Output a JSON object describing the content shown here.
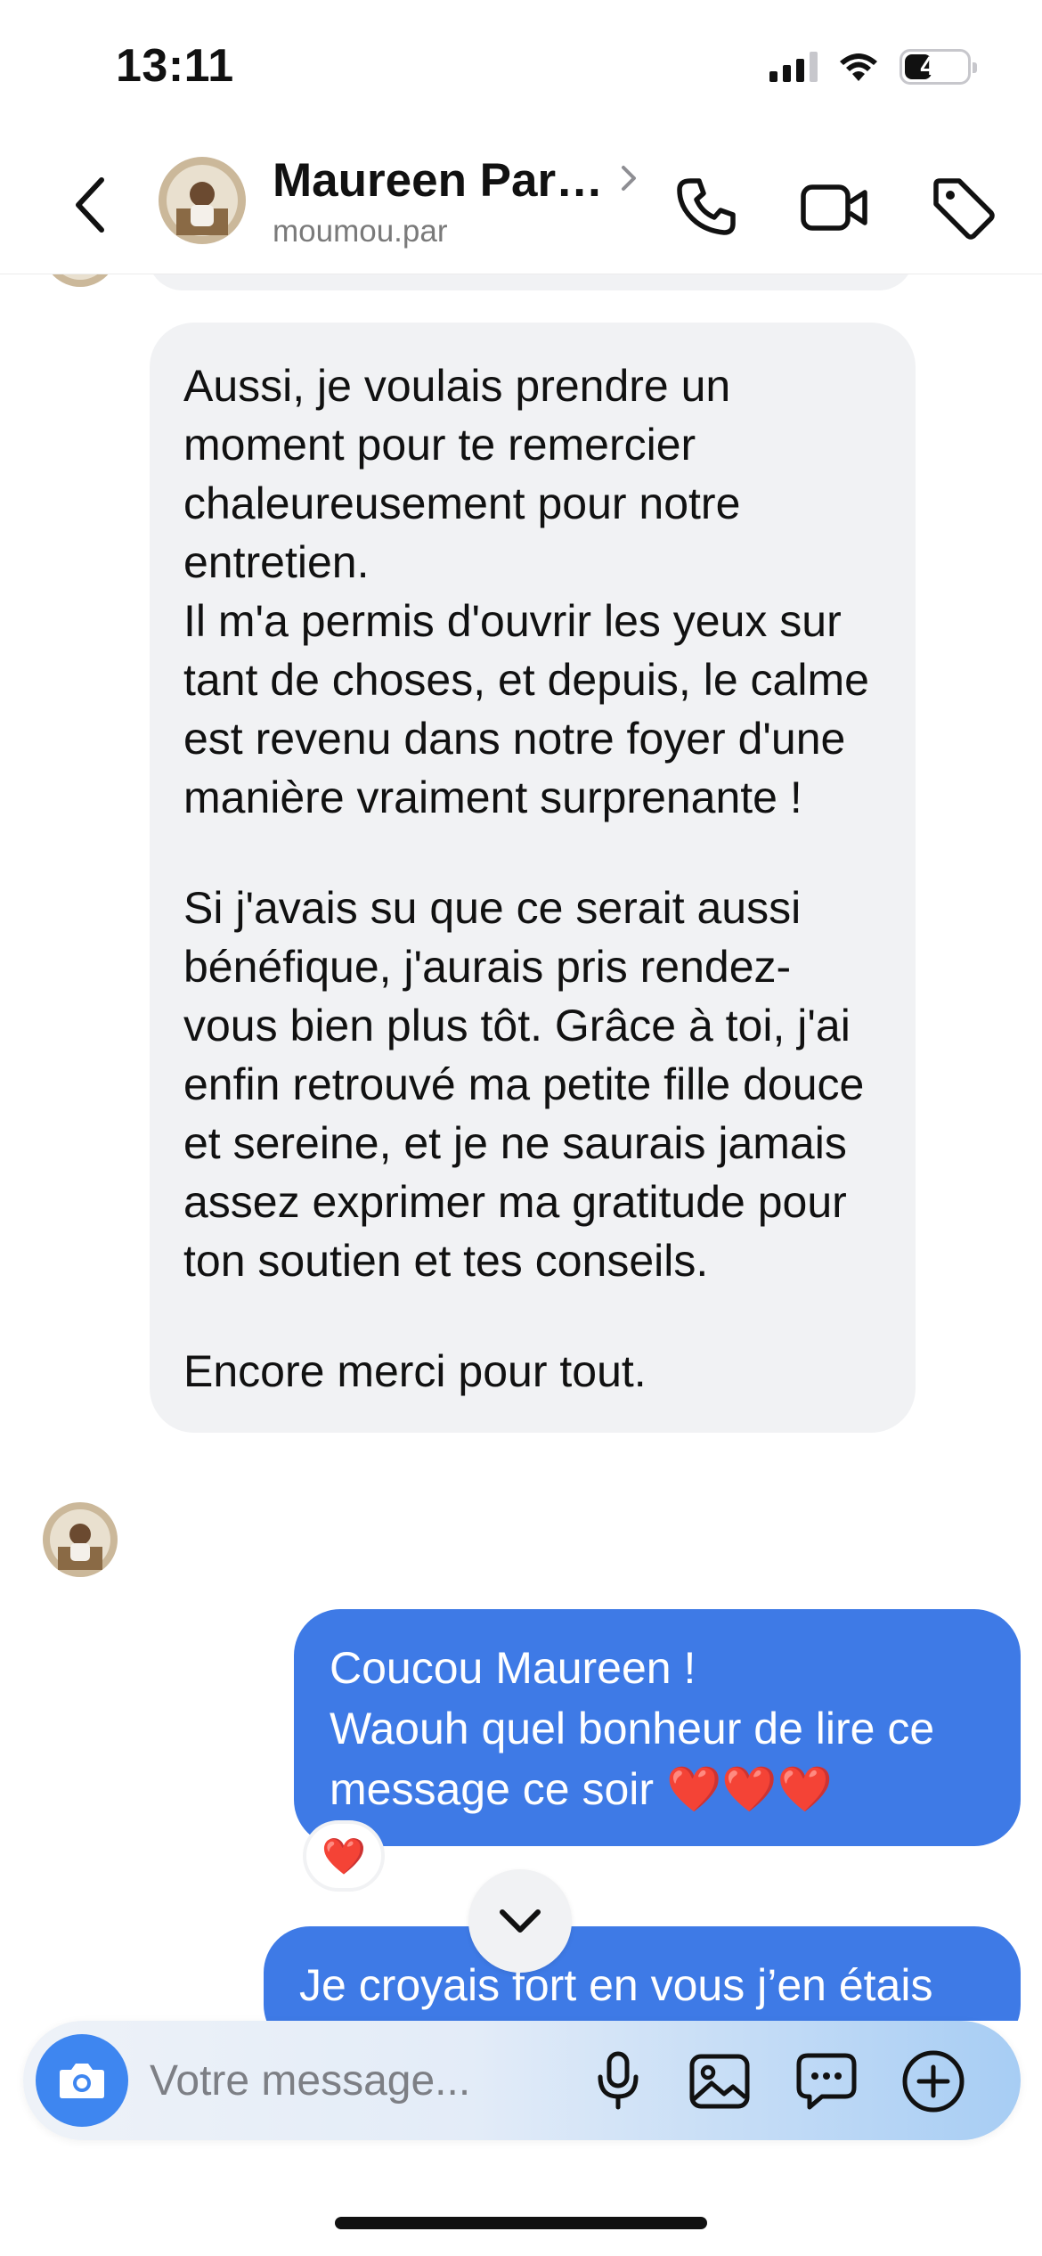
{
  "status_bar": {
    "time": "13:11",
    "battery": "41",
    "signal_bars": 4,
    "signal_active": 3
  },
  "header": {
    "name": "Maureen Par…",
    "username": "moumou.par",
    "icons": [
      "back-icon",
      "chevron-right-icon",
      "phone-icon",
      "video-camera-icon",
      "tag-icon"
    ]
  },
  "messages": {
    "incoming": {
      "paragraph_1": "Aussi, je voulais prendre un moment pour te remercier chaleureusement pour notre entretien.",
      "paragraph_2": "Il m'a permis d'ouvrir les yeux sur tant de choses, et depuis, le calme est revenu dans notre foyer d'une manière vraiment surprenante !",
      "paragraph_3": "Si j'avais su que ce serait aussi bénéfique, j'aurais pris rendez-vous bien plus tôt. Grâce à toi, j'ai enfin retrouvé ma petite fille douce et sereine, et je ne saurais jamais assez exprimer ma gratitude pour ton soutien et tes conseils.",
      "paragraph_4": "Encore merci pour tout."
    },
    "outgoing_1": {
      "line_1": "Coucou Maureen !",
      "line_2": "Waouh quel bonheur de lire ce",
      "line_3": "message ce soir",
      "hearts": "❤️❤️❤️"
    },
    "reaction": "❤️",
    "outgoing_2": {
      "line_1": "Je croyais fort en vous j’en étais"
    }
  },
  "composer": {
    "placeholder": "Votre message...",
    "icons": [
      "camera-icon",
      "microphone-icon",
      "image-icon",
      "chat-bubble-icon",
      "plus-icon"
    ]
  },
  "colors": {
    "outgoing_bubble": "#3e7ae6",
    "incoming_bubble": "#f1f2f4",
    "camera_button": "#3e86f0"
  }
}
